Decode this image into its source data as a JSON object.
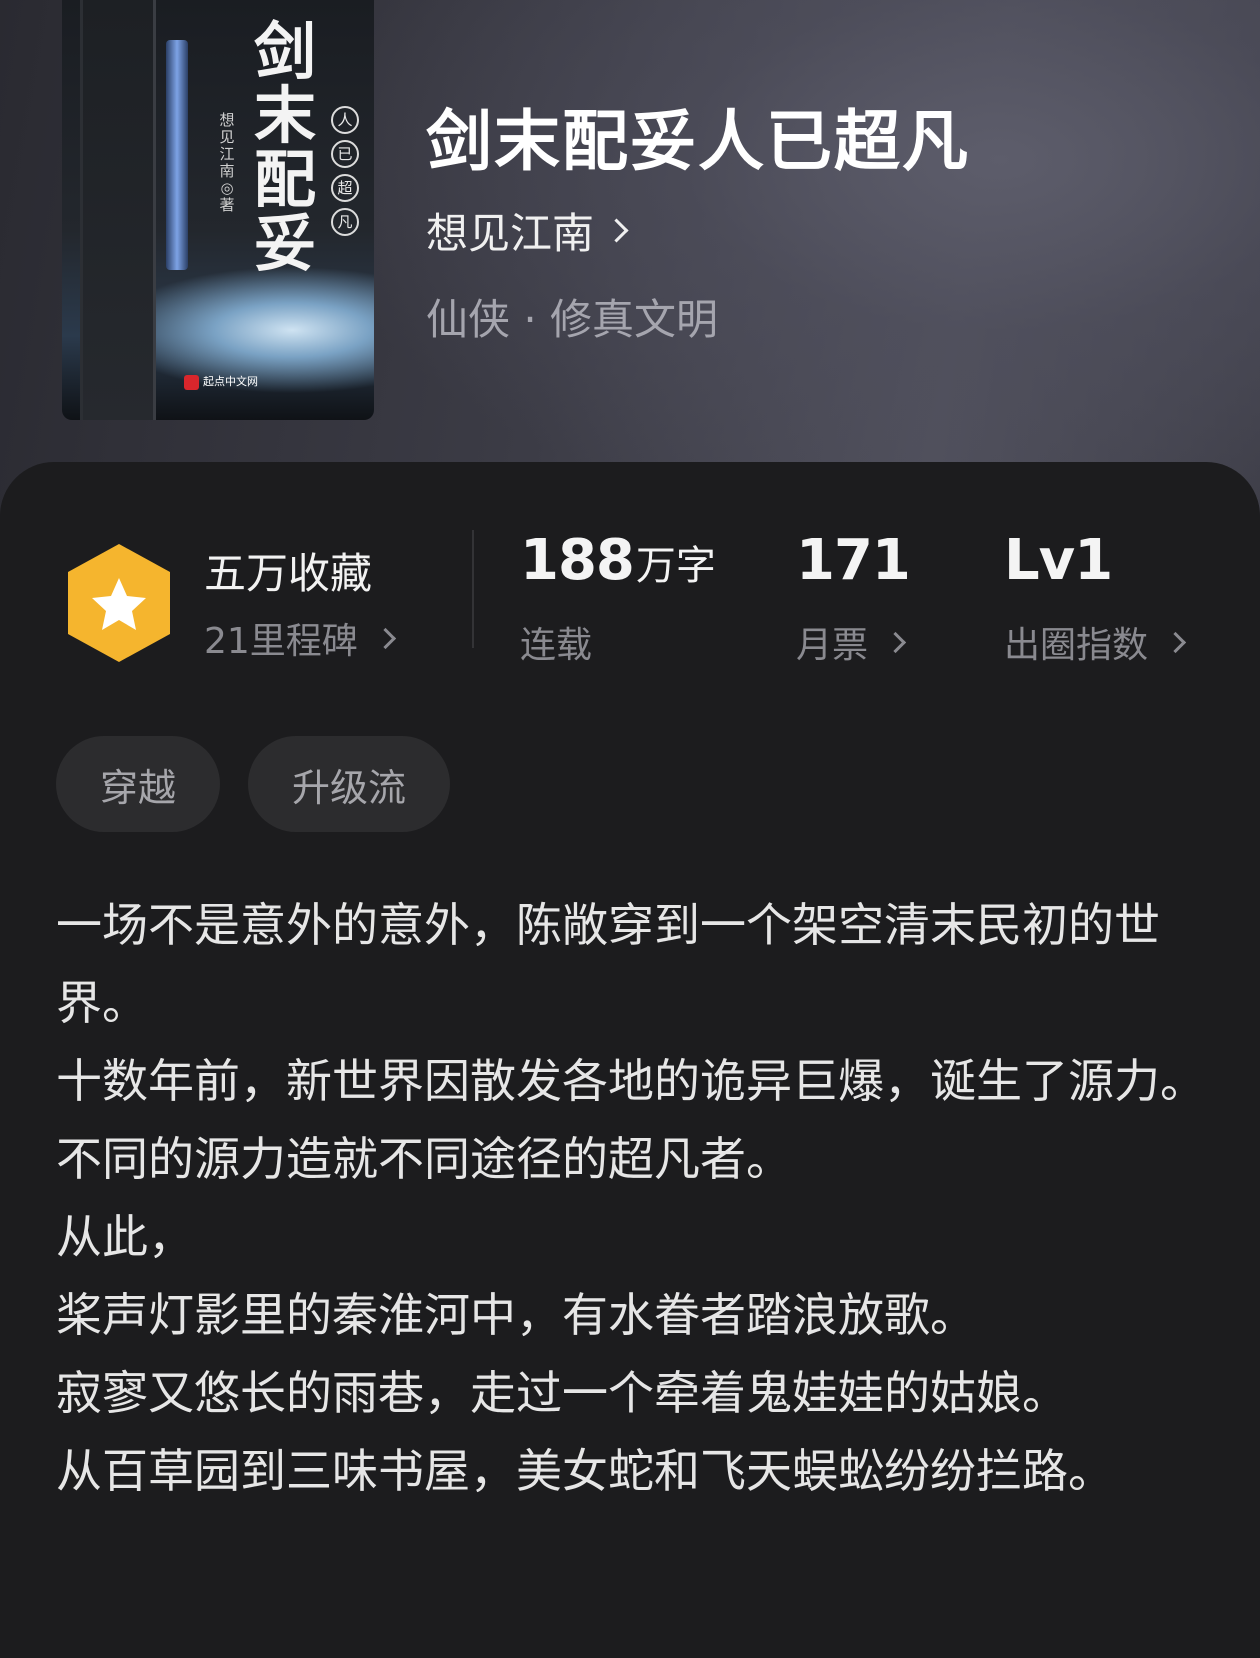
{
  "book": {
    "title": "剑末配妥人已超凡",
    "author": "想见江南",
    "genre": "仙侠 · 修真文明",
    "cover": {
      "title_chars": [
        "剑",
        "末",
        "配",
        "妥"
      ],
      "subtitle_chars": [
        "人",
        "已",
        "超",
        "凡"
      ],
      "author_vertical": "想见江南 ◎ 著",
      "publisher": "起点中文网"
    }
  },
  "stats": {
    "collect": {
      "label": "五万收藏",
      "sub": "21里程碑"
    },
    "words": {
      "value": "188",
      "unit": "万字",
      "sub": "连载"
    },
    "tickets": {
      "value": "171",
      "sub": "月票"
    },
    "level": {
      "value": "Lv1",
      "sub": "出圈指数"
    },
    "badge_color": "#f5b52e"
  },
  "tags": [
    "穿越",
    "升级流"
  ],
  "description": [
    "一场不是意外的意外，陈敞穿到一个架空清末民初的世界。",
    "十数年前，新世界因散发各地的诡异巨爆，诞生了源力。",
    "不同的源力造就不同途径的超凡者。",
    "从此，",
    "桨声灯影里的秦淮河中，有水眷者踏浪放歌。",
    "寂寥又悠长的雨巷，走过一个牵着鬼娃娃的姑娘。",
    "从百草园到三味书屋，美女蛇和飞天蜈蚣纷纷拦路。"
  ]
}
